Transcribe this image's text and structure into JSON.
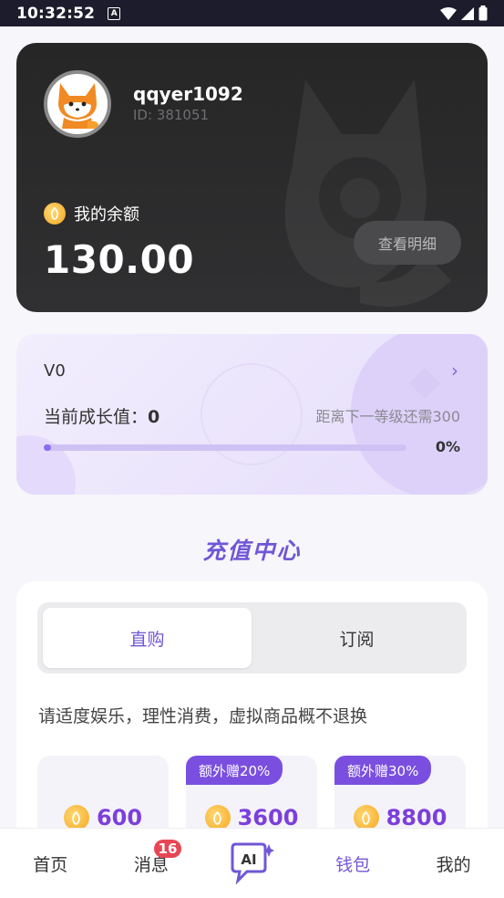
{
  "status_bar": {
    "time": "10:32:52",
    "notification_letter": "A"
  },
  "profile": {
    "username": "qqyer1092",
    "user_id": "ID: 381051"
  },
  "balance": {
    "label": "我的余额",
    "amount": "130.00",
    "detail_button": "查看明细"
  },
  "level": {
    "name": "V0",
    "growth_label": "当前成长值：",
    "growth_value": "0",
    "next_level_text": "距离下一等级还需300",
    "progress_percent_text": "0%",
    "progress": 0.02
  },
  "recharge": {
    "title": "充值中心",
    "tabs": [
      {
        "label": "直购",
        "active": true
      },
      {
        "label": "订阅",
        "active": false
      }
    ],
    "notice": "请适度娱乐，理性消费，虚拟商品概不退换",
    "packages": [
      {
        "bonus": "",
        "amount": "600"
      },
      {
        "bonus": "额外赠20%",
        "amount": "3600"
      },
      {
        "bonus": "额外赠30%",
        "amount": "8800"
      }
    ]
  },
  "bottom_nav": {
    "items": [
      {
        "label": "首页"
      },
      {
        "label": "消息",
        "badge": "16"
      },
      {
        "label": "AI",
        "icon": "ai-chat-icon"
      },
      {
        "label": "钱包",
        "active": true
      },
      {
        "label": "我的"
      }
    ]
  },
  "colors": {
    "accent": "#7057d6",
    "card_dark": "#262626",
    "coin": "#f5a623",
    "badge": "#e84655"
  }
}
